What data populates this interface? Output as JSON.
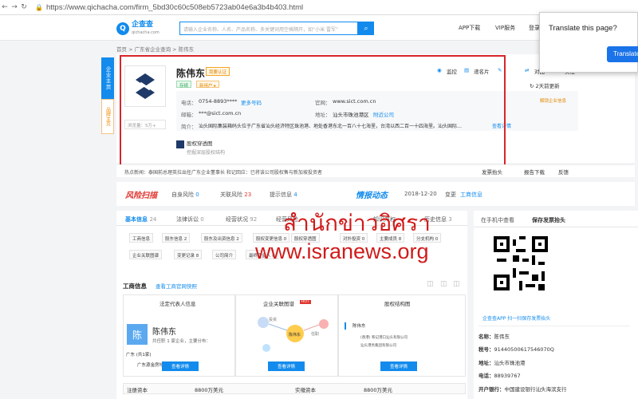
{
  "browser": {
    "url": "https://www.qichacha.com/firm_5bd30c60c508eb5723ab04e6a3b4b403.html"
  },
  "header": {
    "logo_name": "企查查",
    "logo_domain": "qichacha.com",
    "search_placeholder": "请输入企业名称、人名、产品名称、多关键词用空格隔开，如“小米 雷军”",
    "nav": [
      "APP下载",
      "VIP服务",
      "登录"
    ]
  },
  "translate": {
    "question": "Translate this page?",
    "button": "Translate"
  },
  "breadcrumb": "首页 > 广东省企业查询 > 陈伟东",
  "side_tabs": {
    "primary": "企业主页",
    "secondary": "品牌主页"
  },
  "company": {
    "name": "陈伟东",
    "cert": "我要认证",
    "tags": [
      "存续",
      "新用户 ▸"
    ],
    "views": "浏览量：5万+",
    "phone_label": "电话：",
    "phone": "0754-8893****",
    "phone_more": "更多号码",
    "website_label": "官网：",
    "website": "www.sict.com.cn",
    "email_label": "邮箱：",
    "email": "***@sict.com.cn",
    "address_label": "地址：",
    "address": "汕头市珠池港区",
    "nearby": "附近公司",
    "intro_label": "简介：",
    "intro": "汕头国际集装箱码头位于广东省汕头经济特区珠池港、地处香港东北一百八十七海里，台湾以西二百一十四海里。汕头国际…",
    "intro_more": "查看详情",
    "equity_title": "股权穿透图",
    "equity_sub": "挖掘深层股权结构",
    "actions": [
      "监控",
      "递名片",
      "纠错",
      "对比",
      "关注"
    ],
    "update": "2天前更新",
    "claim": "解锁企业信息"
  },
  "hotnews": {
    "label": "热点新闻：",
    "text": "泰国前总理英拉出任广东企业董事长 和记回应：已将该公司股权售与新加坡投资者",
    "actions": [
      "发票抬头",
      "报告下载",
      "反馈"
    ]
  },
  "risk": {
    "title": "风险扫描",
    "items": [
      {
        "label": "自身风险",
        "count": "0"
      },
      {
        "label": "关联风险",
        "count": "23"
      },
      {
        "label": "提示信息",
        "count": "4"
      }
    ],
    "dynamic_title": "情报动态",
    "date": "2018-12-20",
    "change": "变更",
    "change_link": "工商信息"
  },
  "tabs": [
    {
      "label": "基本信息",
      "count": "24"
    },
    {
      "label": "法律诉讼",
      "count": "0"
    },
    {
      "label": "经营状况",
      "count": "92"
    },
    {
      "label": "经营风险",
      "count": ""
    },
    {
      "label": "知识产权",
      "count": ""
    },
    {
      "label": "历史信息",
      "count": "3"
    }
  ],
  "subtabs_row1": [
    "工商信息",
    "股东信息 2",
    "股东及出资信息 2",
    "股权变更信息 0",
    "股权穿透图",
    "对外投资 0",
    "主要成员 8",
    "分支机构 0"
  ],
  "subtabs_row2": [
    "企业关联图谱",
    "变更记录 8",
    "公司简介",
    "最终受益人 0"
  ],
  "business": {
    "title": "工商信息",
    "link": "查看工商官网快照",
    "col_titles": [
      "法定代表人信息",
      "企业关联图谱",
      "股权结构图"
    ],
    "hot_badge": "HOT",
    "legal_initial": "陈",
    "legal_name": "陈伟东",
    "legal_desc": "共任职 1 家企业，主要分布：",
    "legal_region": "广东 (共1家)",
    "legal_company": "广东源金房地产有限公司",
    "graph_labels": [
      "投资",
      "陈伟东",
      "任职"
    ],
    "struct_title": "陈伟东",
    "struct_lines": [
      "(香港) 和记港口汕头有限公司",
      "汕头港务集团有限公司"
    ],
    "view_btn": "查看详情",
    "reg_capital_label": "注册资本",
    "reg_capital": "8800万美元",
    "paid_capital_label": "实缴资本",
    "paid_capital": "8800万美元"
  },
  "right": {
    "tabs": [
      "在手机中查看",
      "保存发票抬头"
    ],
    "app_text": "企查查APP 扫一扫保存发票抬头",
    "details": [
      {
        "label": "名称：",
        "value": "陈伟东"
      },
      {
        "label": "税号：",
        "value": "914405006175460​70Q"
      },
      {
        "label": "地址：",
        "value": "汕头市珠池港"
      },
      {
        "label": "电话：",
        "value": "88939767"
      },
      {
        "label": "开户银行：",
        "value": "中国建设银行汕头海滨支行"
      }
    ]
  },
  "watermark": {
    "line1": "สำนักข่าวอิศรา",
    "line2": "www.isranews.org"
  },
  "colors": {
    "brand": "#128bed",
    "highlight": "#d6262b",
    "watermark": "#d11a1a",
    "cert": "#f5a623"
  }
}
